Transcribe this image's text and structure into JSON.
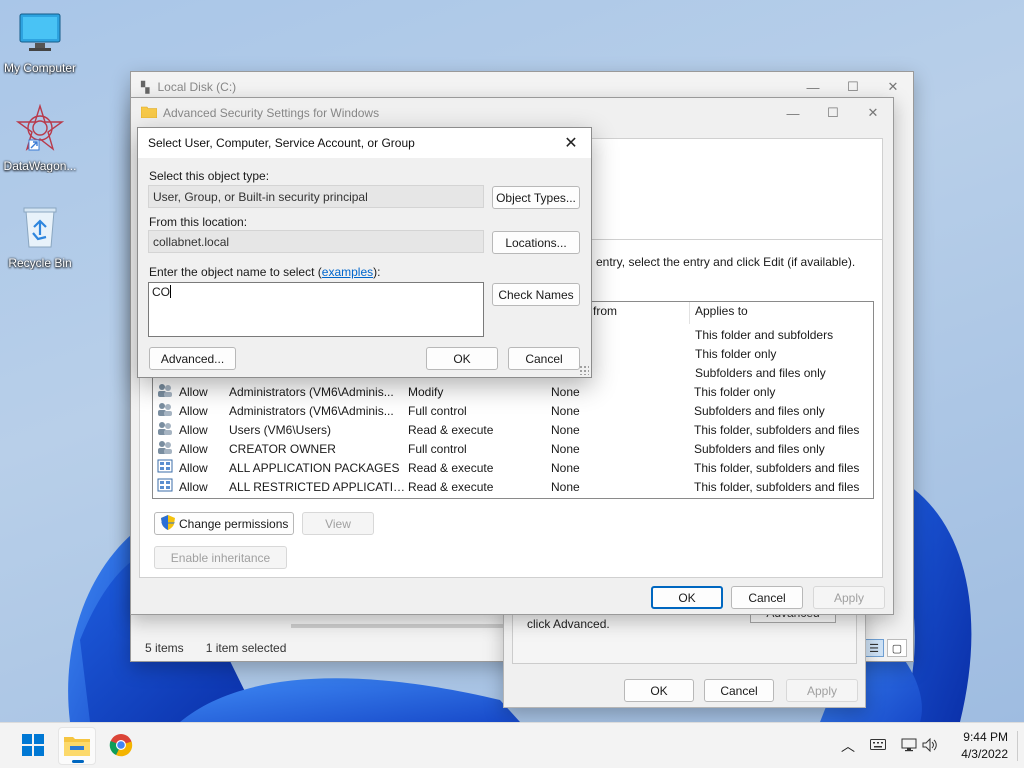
{
  "desktop": {
    "icons": [
      {
        "label": "My Computer"
      },
      {
        "label": "DataWagon..."
      },
      {
        "label": "Recycle Bin"
      }
    ]
  },
  "explorer": {
    "title": "Local Disk (C:)",
    "status_items": "5 items",
    "status_selected": "1 item selected"
  },
  "properties": {
    "hint": "click Advanced.",
    "advanced_label": "Advanced",
    "ok_label": "OK",
    "cancel_label": "Cancel",
    "apply_label": "Apply"
  },
  "advanced_security": {
    "title": "Advanced Security Settings for Windows",
    "instruction": "entry, select the entry and click Edit (if available).",
    "header_inherited": "d from",
    "header_applies": "Applies to",
    "partial_rows": [
      {
        "applies_to": "This folder and subfolders"
      },
      {
        "applies_to": "This folder only"
      },
      {
        "applies_to": "Subfolders and files only"
      }
    ],
    "rows": [
      {
        "type": "Allow",
        "principal": "Administrators (VM6\\Adminis...",
        "access": "Modify",
        "inherited": "None",
        "applies_to": "This folder only",
        "icon": "users-icon"
      },
      {
        "type": "Allow",
        "principal": "Administrators (VM6\\Adminis...",
        "access": "Full control",
        "inherited": "None",
        "applies_to": "Subfolders and files only",
        "icon": "users-icon"
      },
      {
        "type": "Allow",
        "principal": "Users (VM6\\Users)",
        "access": "Read & execute",
        "inherited": "None",
        "applies_to": "This folder, subfolders and files",
        "icon": "users-icon"
      },
      {
        "type": "Allow",
        "principal": "CREATOR OWNER",
        "access": "Full control",
        "inherited": "None",
        "applies_to": "Subfolders and files only",
        "icon": "users-icon"
      },
      {
        "type": "Allow",
        "principal": "ALL APPLICATION PACKAGES",
        "access": "Read & execute",
        "inherited": "None",
        "applies_to": "This folder, subfolders and files",
        "icon": "package-icon"
      },
      {
        "type": "Allow",
        "principal": "ALL RESTRICTED APPLICATIO...",
        "access": "Read & execute",
        "inherited": "None",
        "applies_to": "This folder, subfolders and files",
        "icon": "package-icon"
      }
    ],
    "change_permissions_label": "Change permissions",
    "view_label": "View",
    "enable_inheritance_label": "Enable inheritance",
    "ok_label": "OK",
    "cancel_label": "Cancel",
    "apply_label": "Apply"
  },
  "select_dialog": {
    "title": "Select User, Computer, Service Account, or Group",
    "object_type_label": "Select this object type:",
    "object_type_value": "User, Group, or Built-in security principal",
    "object_types_button": "Object Types...",
    "location_label": "From this location:",
    "location_value": "collabnet.local",
    "locations_button": "Locations...",
    "name_label_prefix": "Enter the object name to select (",
    "name_label_link": "examples",
    "name_label_suffix": "):",
    "name_value": "CO",
    "check_names_button": "Check Names",
    "advanced_button": "Advanced...",
    "ok_button": "OK",
    "cancel_button": "Cancel"
  },
  "taskbar": {
    "time": "9:44 PM",
    "date": "4/3/2022"
  },
  "colors": {
    "accent": "#0067c0",
    "link": "#0066cc"
  }
}
